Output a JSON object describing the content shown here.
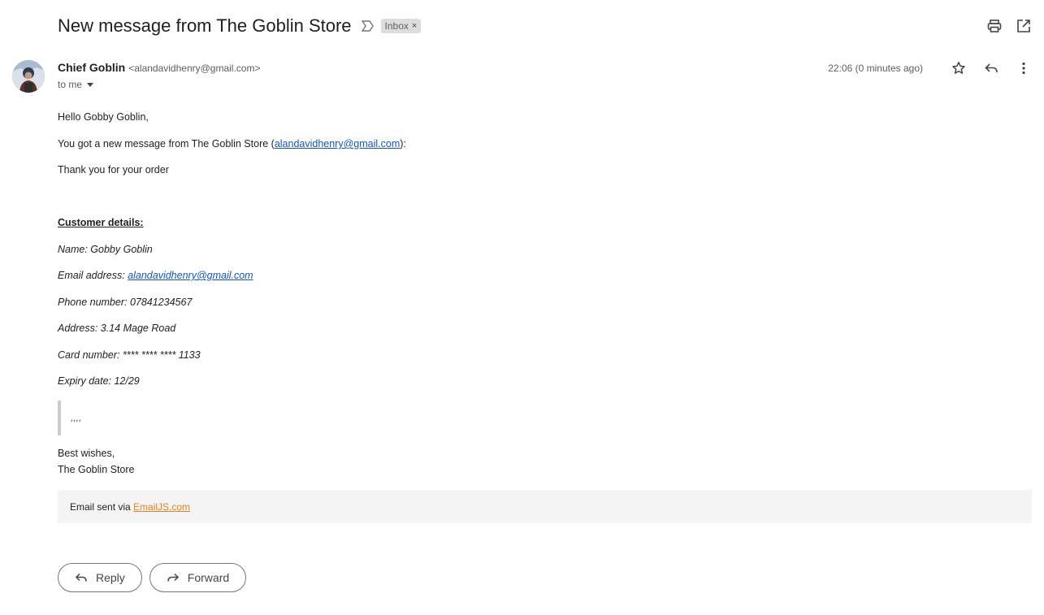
{
  "subject": "New message from The Goblin Store",
  "label": {
    "text": "Inbox",
    "close": "×"
  },
  "top_actions": {
    "print_icon": "printer-icon",
    "open_icon": "open-in-new-icon"
  },
  "sender": {
    "name": "Chief Goblin",
    "email": "<alandavidhenry@gmail.com>",
    "to": "to me",
    "timestamp": "22:06 (0 minutes ago)"
  },
  "message": {
    "greeting": "Hello Gobby Goblin,",
    "intro_prefix": "You got a new message from The Goblin Store (",
    "intro_link": "alandavidhenry@gmail.com",
    "intro_suffix": "):",
    "thanks": "Thank you for your order",
    "details_heading": "Customer details:",
    "name_line": "Name: Gobby Goblin",
    "email_prefix": "Email address: ",
    "email_link": "alandavidhenry@gmail.com",
    "phone_line": "Phone number: 07841234567",
    "address_line": "Address: 3.14 Mage Road",
    "card_line": "Card number: **** **** **** 1133",
    "expiry_line": "Expiry date: 12/29",
    "quote_text": ",,,,",
    "signoff_1": "Best wishes,",
    "signoff_2": "The Goblin Store"
  },
  "footer": {
    "prefix": "Email sent via ",
    "link": "EmailJS.com"
  },
  "buttons": {
    "reply": "Reply",
    "forward": "Forward"
  },
  "colors": {
    "link": "#1155cc",
    "footer_link": "#e8811e",
    "chip_bg": "#dddddd"
  }
}
